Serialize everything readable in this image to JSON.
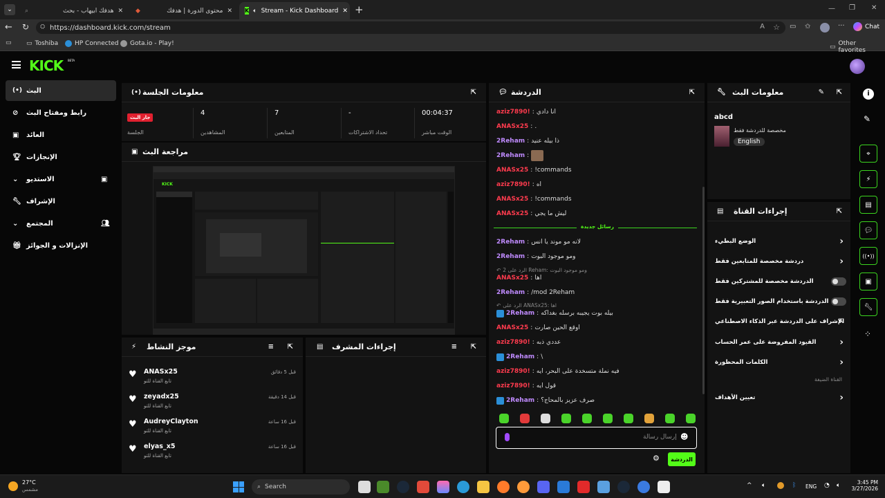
{
  "browser": {
    "tabs": [
      {
        "label": "هدفك ابيهاب - بحث"
      },
      {
        "label": "محتوى الدورة | هدفك"
      },
      {
        "label": "Stream - Kick Dashboard"
      }
    ],
    "url": "https://dashboard.kick.com/stream",
    "chat_label": "Chat",
    "favorites": [
      "Toshiba",
      "HP Connected",
      "Gota.io - Play!"
    ],
    "other_favorites": "Other favorites"
  },
  "app": {
    "logo": "KICK",
    "beta": "BETA",
    "sidebar": [
      {
        "label": "البث"
      },
      {
        "label": "رابط ومفتاح البث"
      },
      {
        "label": "العائد"
      },
      {
        "label": "الإنجازات"
      },
      {
        "label": "الاستديو"
      },
      {
        "label": "الإشراف"
      },
      {
        "label": "المجتمع"
      },
      {
        "label": "الإنزالات و الجوائز"
      }
    ],
    "session": {
      "title": "معلومات الجلسة",
      "live_badge": "جار البث",
      "session_label": "الجلسة",
      "viewers_value": "4",
      "viewers_label": "المشاهدين",
      "followers_value": "7",
      "followers_label": "المتابعين",
      "subs_value": "-",
      "subs_label": "تحداد الاشتراكات",
      "time_value": "00:04:37",
      "time_label": "الوقت مباشر"
    },
    "preview": {
      "title": "مراجعة البث"
    },
    "activity": {
      "title": "موجز النشاط",
      "items": [
        {
          "name": "ANASx25",
          "sub": "تابع القناة للتو",
          "time": "قبل 5 دقائق"
        },
        {
          "name": "zeyadx25",
          "sub": "تابع القناة للتو",
          "time": "قبل 14 دقيقة"
        },
        {
          "name": "AudreyClayton",
          "sub": "تابع القناة للتو",
          "time": "قبل 16 ساعة"
        },
        {
          "name": "elyas_x5",
          "sub": "تابع القناة للتو",
          "time": "قبل 16 ساعة"
        }
      ]
    },
    "mod_actions": {
      "title": "إجراءات المشرف"
    },
    "chat": {
      "title": "الدردشة",
      "new_messages": "رسائل جديدة",
      "messages": [
        {
          "user": "aziz7890!",
          "text": "انا دادي",
          "color": "red"
        },
        {
          "user": "ANASx25",
          "text": ".",
          "color": "red"
        },
        {
          "user": "2Reham",
          "text": "ذا بيله عنيد",
          "color": "purple"
        },
        {
          "user": "2Reham",
          "text": "",
          "color": "purple"
        },
        {
          "user": "ANASx25",
          "text": "!commands",
          "color": "red"
        },
        {
          "user": "aziz7890!",
          "text": "اه",
          "color": "red"
        },
        {
          "user": "ANASx25",
          "text": "!commands",
          "color": "red"
        },
        {
          "user": "ANASx25",
          "text": "ليش ما يجي",
          "color": "red"
        },
        {
          "user": "2Reham",
          "text": "لانه مو موند يا انس",
          "color": "purple"
        },
        {
          "user": "2Reham",
          "text": "ومو موجود البوت",
          "color": "purple"
        },
        {
          "user": "ANASx25",
          "text": "اها",
          "color": "red"
        },
        {
          "user": "2Reham",
          "text": "/mod 2Reham",
          "color": "purple"
        },
        {
          "user": "2Reham",
          "text": "بيله بوت يجيبه برسله بغداكه",
          "color": "purple"
        },
        {
          "user": "ANASx25",
          "text": "اوقع الحين صارت",
          "color": "red"
        },
        {
          "user": "aziz7890!",
          "text": "عددي ذبه",
          "color": "red"
        },
        {
          "user": "2Reham",
          "text": "\\",
          "color": "purple"
        },
        {
          "user": "aziz7890!",
          "text": "فيه نملة متسخدة على البحر، ايه",
          "color": "red"
        },
        {
          "user": "aziz7890!",
          "text": "قول ايه",
          "color": "red"
        },
        {
          "user": "2Reham",
          "text": "صرف عزيز بالمحاج؟",
          "color": "purple"
        }
      ],
      "reply1": "الرد على 2 Reham: ومو موجود البوت",
      "reply2": "الرد على ANASx25: اها",
      "input_placeholder": "إرسال رسالة",
      "send_button": "الدردشة"
    },
    "stream_info": {
      "title": "معلومات البث",
      "stream_title": "abcd",
      "category": "مخصصة للدردشة فقط",
      "language": "English"
    },
    "channel_actions": {
      "title": "إجراءات القناة",
      "items": [
        {
          "label": "الوضع البطيء",
          "control": "chevron"
        },
        {
          "label": "دردشة مخصصة للمتابعين فقط",
          "control": "chevron"
        },
        {
          "label": "الدردشة مخصصة للمشتركين فقط",
          "control": "toggle"
        },
        {
          "label": "الدردشة باستخدام الصور التعبيرية فقط",
          "control": "toggle"
        },
        {
          "label": "الإشراف على الدردشة عبر الذكاء الاصطناعي",
          "control": "external"
        },
        {
          "label": "القيود المفروضة على عمر الحساب",
          "control": "chevron"
        },
        {
          "label": "الكلمات المحظورة",
          "control": "chevron"
        }
      ],
      "guest_channel": "القناة الضيفة",
      "set_goals": "تعيين الأهداف"
    }
  },
  "taskbar": {
    "weather_temp": "27°C",
    "weather_desc": "مشمس",
    "search": "Search",
    "lang": "ENG",
    "time": "3:45 PM",
    "date": "3/27/2026"
  },
  "colors": {
    "accent": "#53fc18",
    "live": "#e0202f",
    "bg": "#070707",
    "panel": "#131313"
  }
}
